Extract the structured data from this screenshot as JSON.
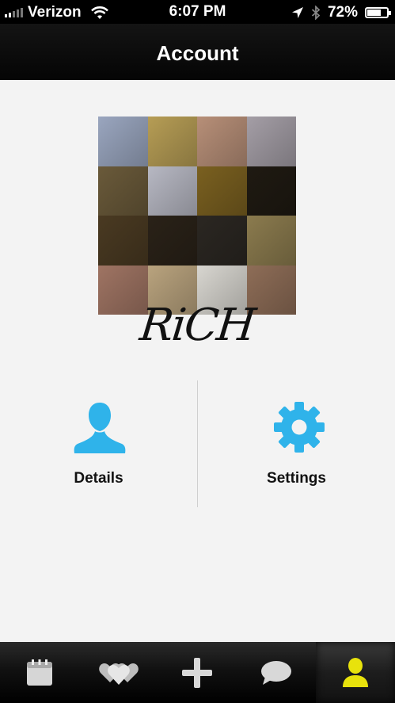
{
  "status_bar": {
    "carrier": "Verizon",
    "time": "6:07 PM",
    "battery": "72%",
    "battery_level": 0.72
  },
  "nav": {
    "title": "Account"
  },
  "profile": {
    "name_signature": "RiCH",
    "avatar_tiles": [
      "#9aa6bf",
      "#b69d55",
      "#b78f78",
      "#a49ea6",
      "#6a5a3a",
      "#b7b8c3",
      "#7a6020",
      "#1f1a12",
      "#4a3a22",
      "#2a2218",
      "#2b2722",
      "#8b7b4e",
      "#9f7463",
      "#b9a37e",
      "#d8d6d0",
      "#8e6d57"
    ]
  },
  "actions": {
    "details_label": "Details",
    "settings_label": "Settings",
    "icon_color": "#2fb3ea"
  },
  "tab_bar": {
    "items": [
      "calendar-icon",
      "hearts-icon",
      "plus-icon",
      "chat-bubble-icon",
      "person-icon"
    ],
    "active": "person-icon",
    "active_color": "#e8e20c"
  }
}
